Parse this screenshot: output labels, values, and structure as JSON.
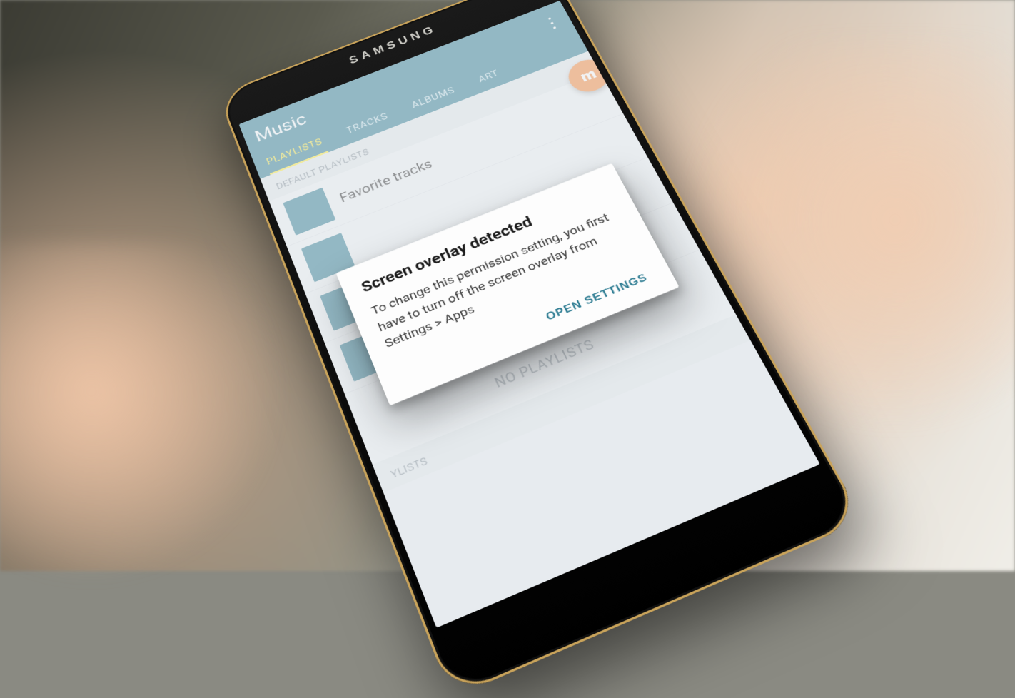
{
  "device": {
    "brand": "SAMSUNG"
  },
  "app": {
    "title": "Music",
    "tabs": [
      {
        "label": "PLAYLISTS",
        "active": true
      },
      {
        "label": "TRACKS"
      },
      {
        "label": "ALBUMS"
      },
      {
        "label": "ART"
      }
    ]
  },
  "sections": {
    "default_header": "DEFAULT PLAYLISTS",
    "items": [
      {
        "title": "Favorite tracks"
      }
    ],
    "empty_label": "NO PLAYLISTS",
    "my_header": "YLISTS"
  },
  "overlay_badge": {
    "text": "m"
  },
  "dialog": {
    "title": "Screen overlay detected",
    "body": "To change this permission setting, you first have to turn off the screen overlay from Settings > Apps",
    "action": "OPEN SETTINGS"
  }
}
